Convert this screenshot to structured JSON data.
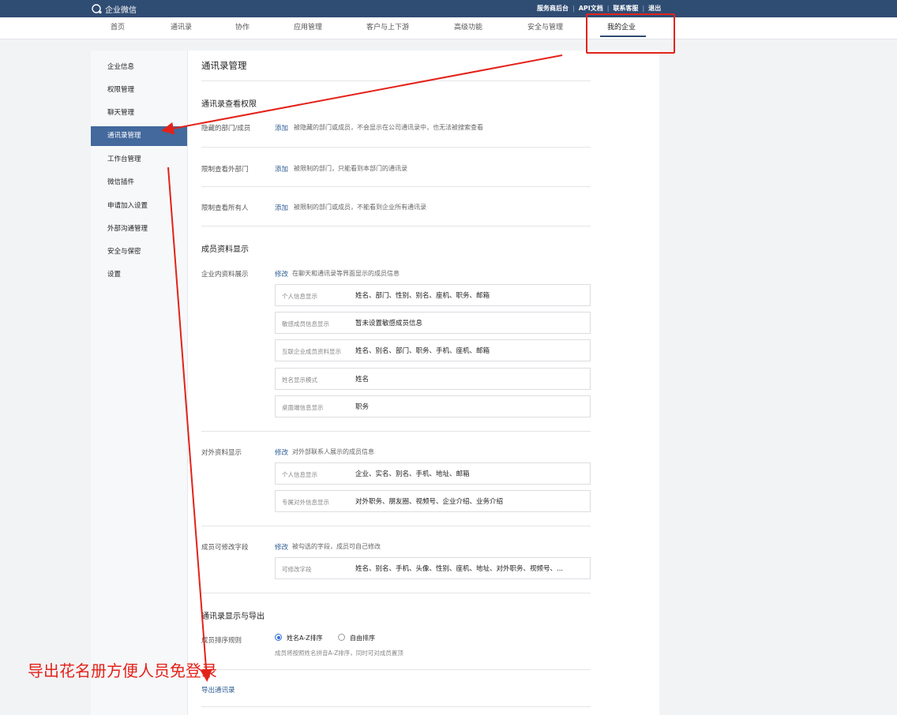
{
  "app": {
    "logo_text": "企业微信"
  },
  "top_links": [
    "服务商后台",
    "API文档",
    "联系客服",
    "退出"
  ],
  "nav": {
    "items": [
      "首页",
      "通讯录",
      "协作",
      "应用管理",
      "客户与上下游",
      "高级功能",
      "安全与管理",
      "我的企业"
    ],
    "active": "我的企业"
  },
  "sidebar": {
    "items": [
      "企业信息",
      "权限管理",
      "聊天管理",
      "通讯录管理",
      "工作台管理",
      "微信插件",
      "申请加入设置",
      "外部沟通管理",
      "安全与保密",
      "设置"
    ],
    "active": "通讯录管理"
  },
  "page": {
    "title": "通讯录管理",
    "view_perm": {
      "title": "通讯录查看权限",
      "rows": [
        {
          "label": "隐藏的部门/成员",
          "action": "添加",
          "desc": "被隐藏的部门或成员，不会显示在公司通讯录中，也无法被搜索查看"
        },
        {
          "label": "限制查看外部门",
          "action": "添加",
          "desc": "被限制的部门，只能看到本部门的通讯录"
        },
        {
          "label": "限制查看所有人",
          "action": "添加",
          "desc": "被限制的部门或成员，不能看到企业所有通讯录"
        }
      ]
    },
    "profile_display": {
      "title": "成员资料显示",
      "internal": {
        "label": "企业内资料展示",
        "action": "修改",
        "desc": "在聊天和通讯录等界面显示的成员信息",
        "fields": [
          {
            "label": "个人信息显示",
            "value": "姓名、部门、性别、别名、座机、职务、邮箱"
          },
          {
            "label": "敏感成员信息显示",
            "value": "暂未设置敏感成员信息"
          },
          {
            "label": "互联企业成员资料显示",
            "value": "姓名、别名、部门、职务、手机、座机、邮箱"
          },
          {
            "label": "姓名显示模式",
            "value": "姓名"
          },
          {
            "label": "桌面端信息显示",
            "value": "职务"
          }
        ]
      },
      "external": {
        "label": "对外资料显示",
        "action": "修改",
        "desc": "对外部联系人展示的成员信息",
        "fields": [
          {
            "label": "个人信息显示",
            "value": "企业、实名、别名、手机、地址、邮箱"
          },
          {
            "label": "专属对外信息显示",
            "value": "对外职务、朋友圈、视频号、企业介绍、业务介绍"
          }
        ]
      },
      "editable": {
        "label": "成员可修改字段",
        "action": "修改",
        "desc": "被勾选的字段，成员可自己修改",
        "fields": [
          {
            "label": "可修改字段",
            "value": "姓名、别名、手机、头像、性别、座机、地址、对外职务、视频号、..."
          }
        ]
      }
    },
    "display_export": {
      "title": "通讯录显示与导出",
      "sort_label": "成员排序规则",
      "sort_options": [
        "姓名A-Z排序",
        "自由排序"
      ],
      "sort_selected": "姓名A-Z排序",
      "sort_hint": "成员将按照姓名拼音A-Z排序，同时可对成员置顶",
      "export_link": "导出通讯录"
    }
  },
  "annotation": {
    "text": "导出花名册方便人员免登录",
    "color": "#e3221a"
  }
}
